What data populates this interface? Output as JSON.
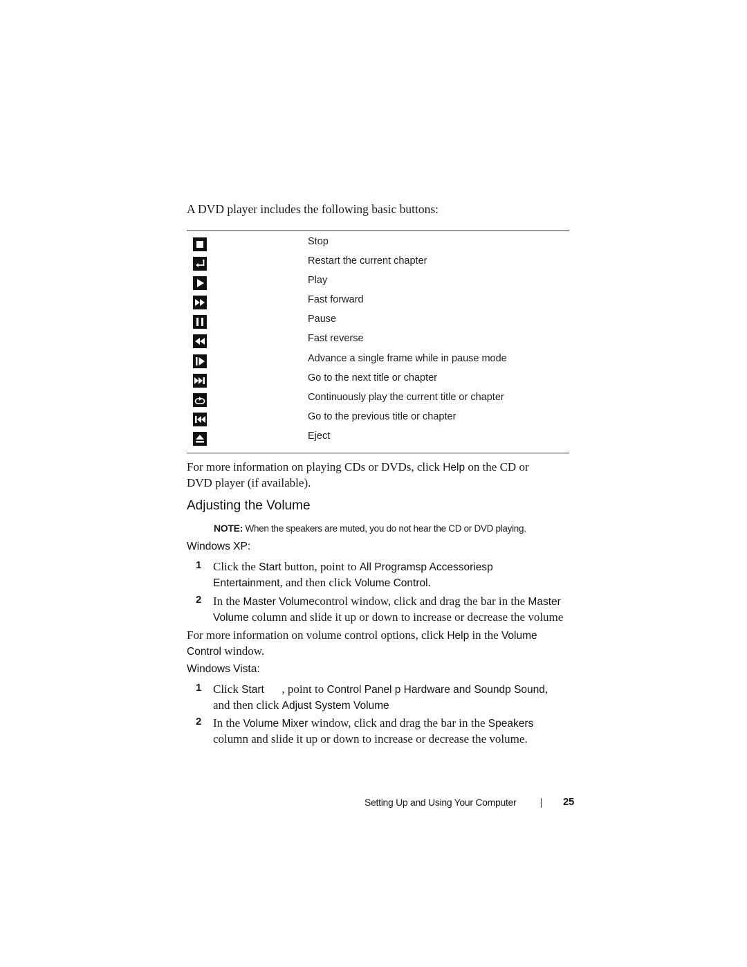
{
  "intro": "A DVD player includes the following basic buttons:",
  "buttons": [
    {
      "icon": "stop-icon",
      "label": "Stop"
    },
    {
      "icon": "restart-chapter-icon",
      "label": "Restart the current chapter"
    },
    {
      "icon": "play-icon",
      "label": "Play"
    },
    {
      "icon": "fast-forward-icon",
      "label": "Fast forward"
    },
    {
      "icon": "pause-icon",
      "label": "Pause"
    },
    {
      "icon": "fast-reverse-icon",
      "label": "Fast reverse"
    },
    {
      "icon": "frame-advance-icon",
      "label": "Advance a single frame while in pause mode"
    },
    {
      "icon": "next-title-icon",
      "label": "Go to the next title or chapter"
    },
    {
      "icon": "repeat-icon",
      "label": "Continuously play the current title or chapter"
    },
    {
      "icon": "previous-title-icon",
      "label": "Go to the previous title or chapter"
    },
    {
      "icon": "eject-icon",
      "label": "Eject"
    }
  ],
  "more_info_cd": {
    "pre": "For more information on playing CDs or DVDs, click ",
    "ui": "Help",
    "post_line1": " on the CD or",
    "line2": "DVD player (if available)."
  },
  "heading": "Adjusting the Volume",
  "note": {
    "label": "NOTE:",
    "text": " When the speakers are muted, you do not hear the CD or DVD playing."
  },
  "xp": {
    "title": "Windows XP:",
    "step1": {
      "num": "1",
      "t1": "Click the ",
      "u1": "Start",
      "t2": " button, point to ",
      "u2": "All Programsp  Accessories",
      "u3": "p",
      "u4": "Entertainment",
      "t3": ", and then click ",
      "u5": "Volume Control",
      "t4": "."
    },
    "step2": {
      "num": "2",
      "t1": "In the ",
      "u1": "Master Volume",
      "t2": "control window, click and drag the bar in the ",
      "u2": "Master",
      "u3": "Volume",
      "t3": " column and slide it up or down to increase or decrease the volume"
    }
  },
  "more_info_volume": {
    "pre": "For more information on volume control options, click ",
    "ui1": "Help",
    "mid": " in the ",
    "ui2": "Volume",
    "ui3": "Control",
    "post": "  window."
  },
  "vista": {
    "title": "Windows Vista:",
    "step1": {
      "num": "1",
      "t1": "Click ",
      "u1": "Start",
      "t2": "      , point to ",
      "u2": "Control Panel p  Hardware and Sound",
      "u3": "p  Sound",
      "t3": ",",
      "t4": "and then click ",
      "u4": "Adjust System Volume"
    },
    "step2": {
      "num": "2",
      "t1": "In the ",
      "u1": "Volume Mixer",
      "t2": " window, click and drag the bar in the ",
      "u2": "Speakers",
      "t3": "column and slide it up or down to increase or decrease the volume."
    }
  },
  "footer": {
    "section": "Setting Up and Using Your Computer",
    "page": "25"
  }
}
